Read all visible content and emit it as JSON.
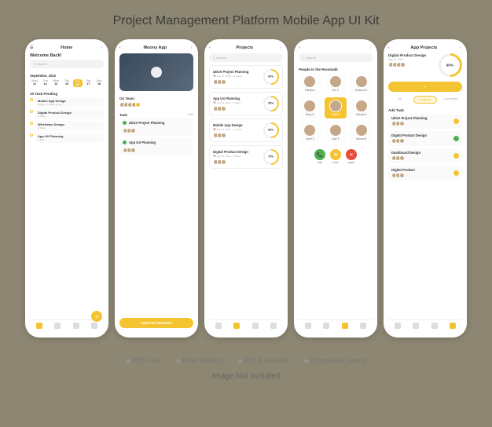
{
  "main_title": "Project Management Platform Mobile App UI Kit",
  "footer": [
    "PSD File",
    "Pixel Perfect",
    "iOS & Android",
    "Organized Layers"
  ],
  "disclaimer": "Image Not Included",
  "screen1": {
    "header": "Home",
    "welcome": "Welcome Back!",
    "search_placeholder": "Search",
    "month": "September, 2022",
    "days": [
      {
        "d": "Mon",
        "n": "12"
      },
      {
        "d": "Tue",
        "n": "13"
      },
      {
        "d": "Wed",
        "n": "14"
      },
      {
        "d": "Thu",
        "n": "15"
      },
      {
        "d": "Fri",
        "n": "16"
      },
      {
        "d": "Sat",
        "n": "17"
      },
      {
        "d": "Sun",
        "n": "18"
      }
    ],
    "active_day": 4,
    "pending_label": "10 Task Pending",
    "tasks": [
      {
        "title": "Mobile App Design",
        "meta": "6 Days · 5 Tasks Done"
      },
      {
        "title": "Digital Product Design",
        "meta": "3 Tasks"
      },
      {
        "title": "Wireframe Design",
        "meta": "4 Tasks"
      },
      {
        "title": "App UX Planning",
        "meta": "1 Task"
      }
    ]
  },
  "screen2": {
    "header": "Moony App",
    "on_team": "On Team",
    "task_label": "Task",
    "task_sub": "Task",
    "tasks": [
      {
        "title": "UI/UX Project Planning",
        "done": true
      },
      {
        "title": "App UX Planning",
        "done": true
      }
    ],
    "button": "CREATE PROJECT"
  },
  "screen3": {
    "header": "Projects",
    "search_placeholder": "Search",
    "projects": [
      {
        "title": "UI/UX Project Planning",
        "date": "Sep 16, 2022",
        "tasks": "10 Tasks",
        "pct": "60%"
      },
      {
        "title": "App UX Planning",
        "date": "Sep 16, 2022",
        "tasks": "8 Tasks",
        "pct": "90%"
      },
      {
        "title": "Mobile App Design",
        "date": "Sep 16, 2022",
        "tasks": "12 Tasks",
        "pct": "50%"
      },
      {
        "title": "Digital Product Design",
        "date": "Sep 16, 2022",
        "tasks": "6 Tasks",
        "pct": "75%"
      }
    ]
  },
  "screen4": {
    "search_placeholder": "Search",
    "section": "People in the Roomtalk",
    "people": [
      {
        "name": "Priscila A"
      },
      {
        "name": "Jim C"
      },
      {
        "name": "Emanuel E"
      },
      {
        "name": "Ruby S"
      },
      {
        "name": "Jacob K"
      },
      {
        "name": "Victoria S"
      },
      {
        "name": "Janet S"
      },
      {
        "name": "Josh P"
      },
      {
        "name": "Norma M"
      }
    ],
    "active_person": 4,
    "actions": {
      "call": "Call",
      "invite": "Invite",
      "leave": "Leave"
    }
  },
  "screen5": {
    "header": "App Projects",
    "top_project": {
      "title": "Digital Product Design",
      "date": "Sep 16, 2022",
      "pct": "60%"
    },
    "button": "Add Task",
    "tabs": [
      "All",
      "Ongoing",
      "Completed"
    ],
    "active_tab": 1,
    "section": "Add Task",
    "tasks": [
      {
        "title": "UI/UX Project Planning",
        "done": false
      },
      {
        "title": "Digital Product Design",
        "done": true
      },
      {
        "title": "Dashboard Design",
        "done": false
      },
      {
        "title": "Digital Product",
        "done": false
      }
    ]
  }
}
